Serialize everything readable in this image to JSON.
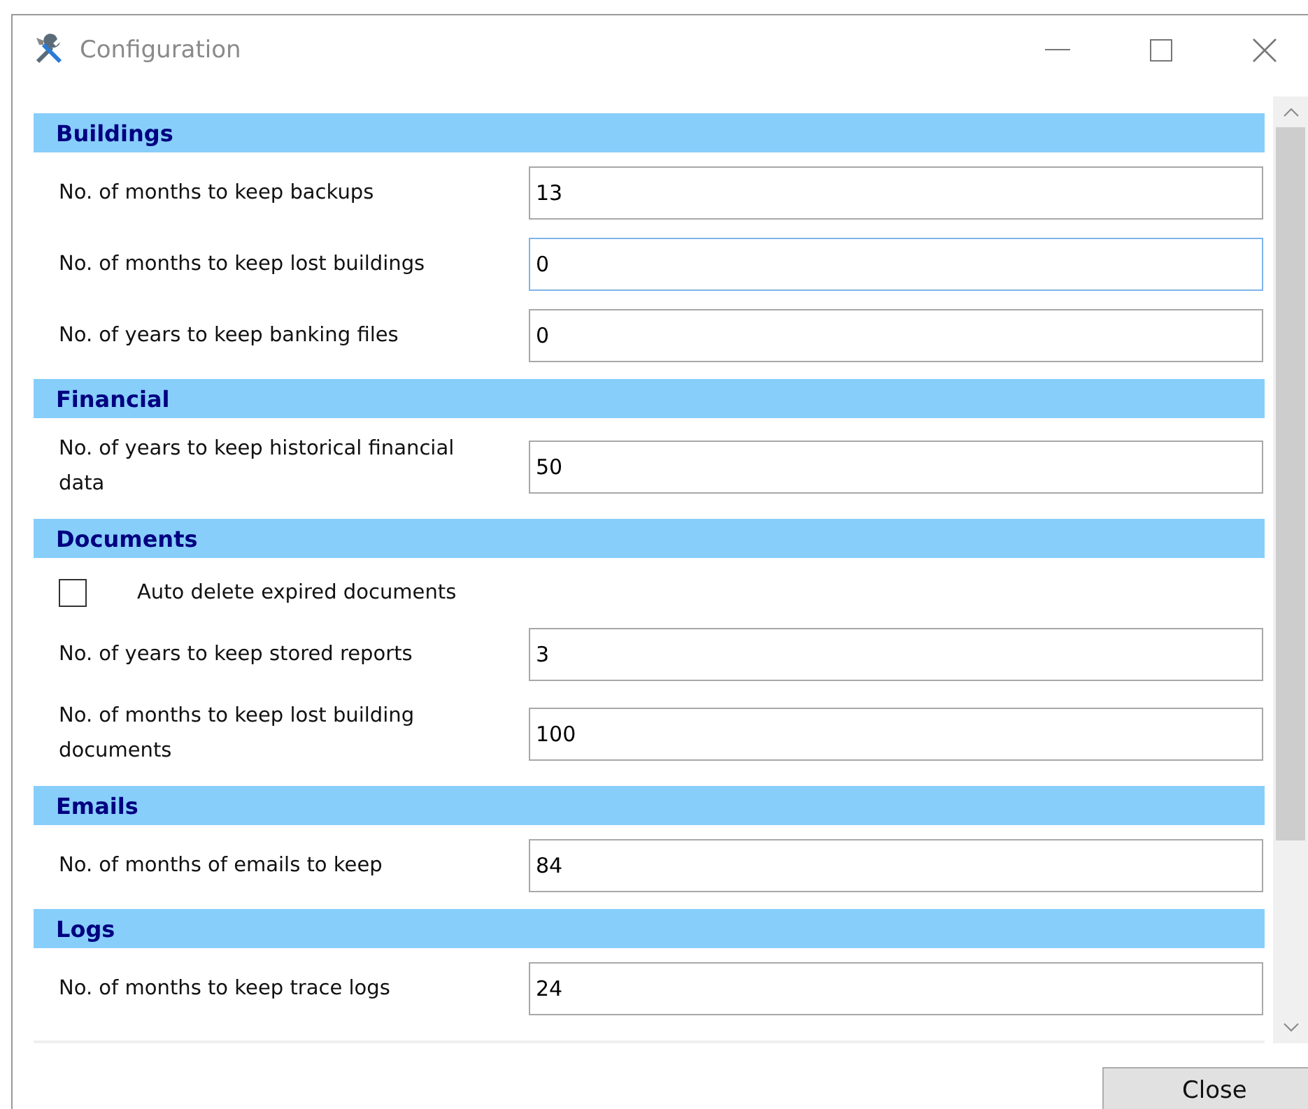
{
  "window": {
    "title": "Configuration"
  },
  "sections": [
    {
      "title": "Buildings",
      "rows": [
        {
          "kind": "field",
          "label": "No. of months to keep backups",
          "value": "13",
          "focused": false
        },
        {
          "kind": "field",
          "label": "No. of months to keep lost buildings",
          "value": "0",
          "focused": true
        },
        {
          "kind": "field",
          "label": "No. of years to keep banking files",
          "value": "0",
          "focused": false
        }
      ]
    },
    {
      "title": "Financial",
      "rows": [
        {
          "kind": "field",
          "label": "No. of years to keep historical financial data",
          "value": "50",
          "focused": false
        }
      ]
    },
    {
      "title": "Documents",
      "rows": [
        {
          "kind": "checkbox",
          "label": "Auto delete expired documents",
          "checked": false
        },
        {
          "kind": "field",
          "label": "No. of years to keep stored reports",
          "value": "3",
          "focused": false
        },
        {
          "kind": "field",
          "label": "No. of months to keep lost building documents",
          "value": "100",
          "focused": false
        }
      ]
    },
    {
      "title": "Emails",
      "rows": [
        {
          "kind": "field",
          "label": "No. of months of emails to keep",
          "value": "84",
          "focused": false
        }
      ]
    },
    {
      "title": "Logs",
      "rows": [
        {
          "kind": "field",
          "label": "No. of months to keep trace logs",
          "value": "24",
          "focused": false
        }
      ]
    }
  ],
  "buttons": [
    {
      "label": "Close"
    }
  ]
}
